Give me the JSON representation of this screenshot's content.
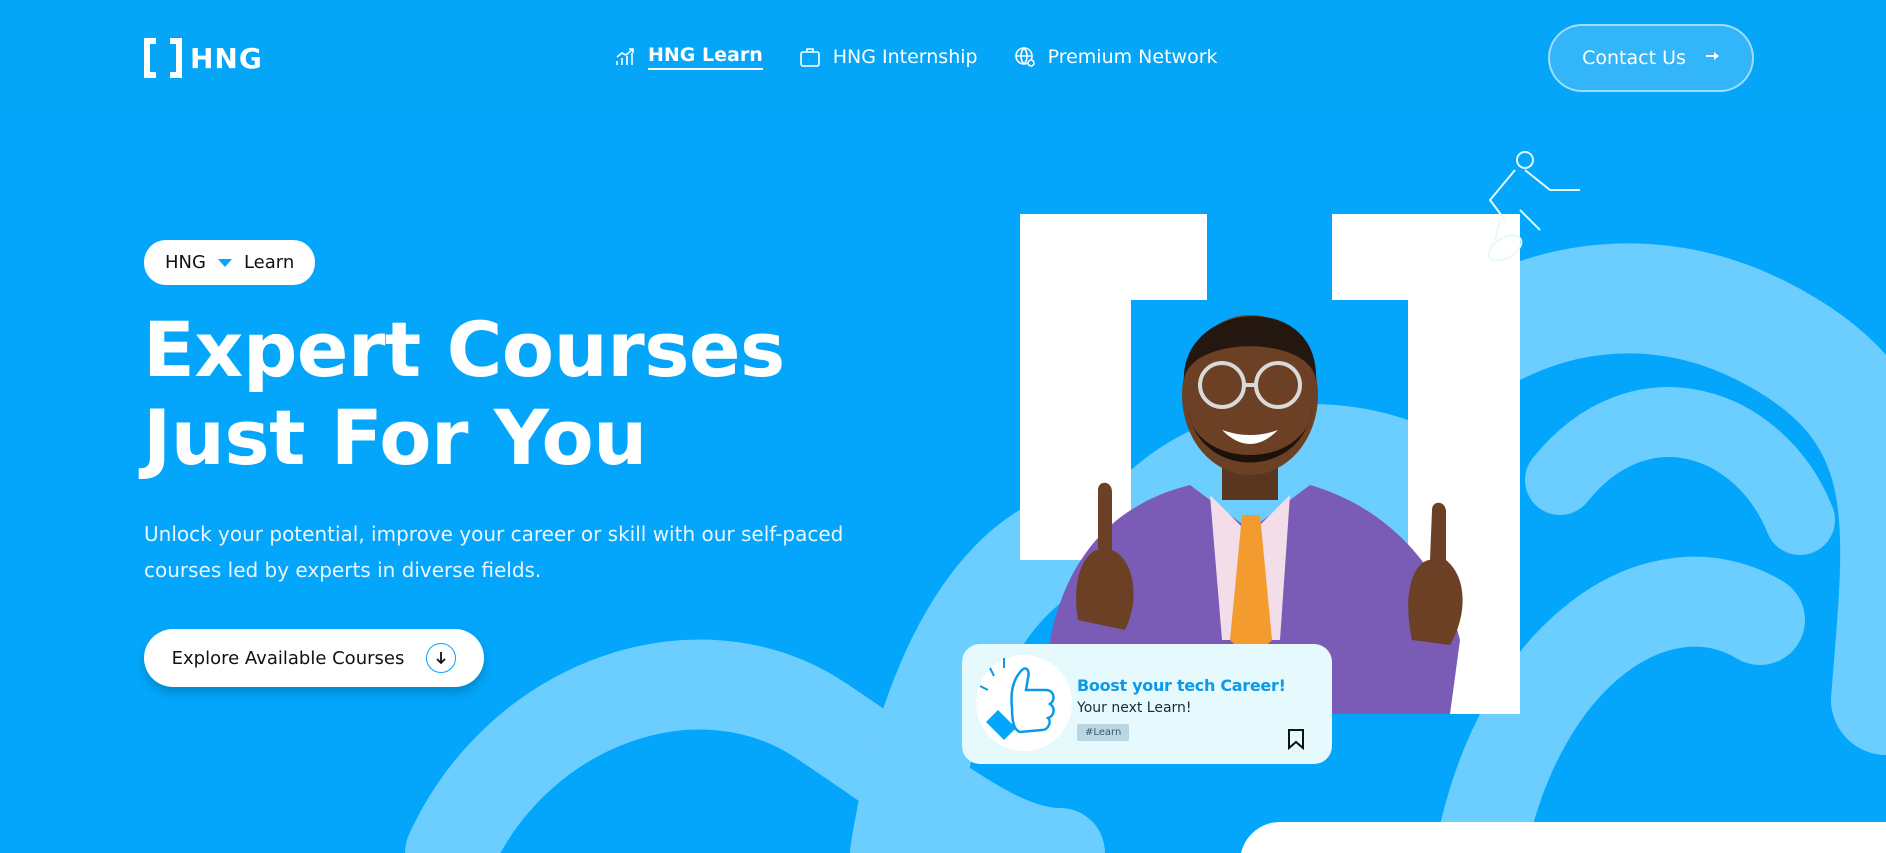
{
  "brand": {
    "name": "HNG"
  },
  "nav": {
    "items": [
      {
        "label": "HNG Learn",
        "icon": "chart-growth-icon",
        "active": true
      },
      {
        "label": "HNG Internship",
        "icon": "briefcase-icon",
        "active": false
      },
      {
        "label": "Premium Network",
        "icon": "globe-icon",
        "active": false
      }
    ]
  },
  "header": {
    "contact_label": "Contact Us"
  },
  "hero": {
    "pill_left": "HNG",
    "pill_right": "Learn",
    "title_line1": "Expert Courses",
    "title_line2": "Just For You",
    "subtitle_line1": "Unlock your potential, improve your career or skill with our self-paced",
    "subtitle_line2": "courses led by experts in diverse fields.",
    "cta_label": "Explore Available Courses"
  },
  "card": {
    "title": "Boost your tech Career!",
    "subtitle": "Your next Learn!",
    "tag": "#Learn"
  },
  "colors": {
    "background": "#03a6fa",
    "swirl": "#6ccdff",
    "card_bg": "#e6f9fd",
    "accent_text": "#0a9ae8",
    "suit": "#7a5bb5",
    "tie": "#f39b2e"
  }
}
